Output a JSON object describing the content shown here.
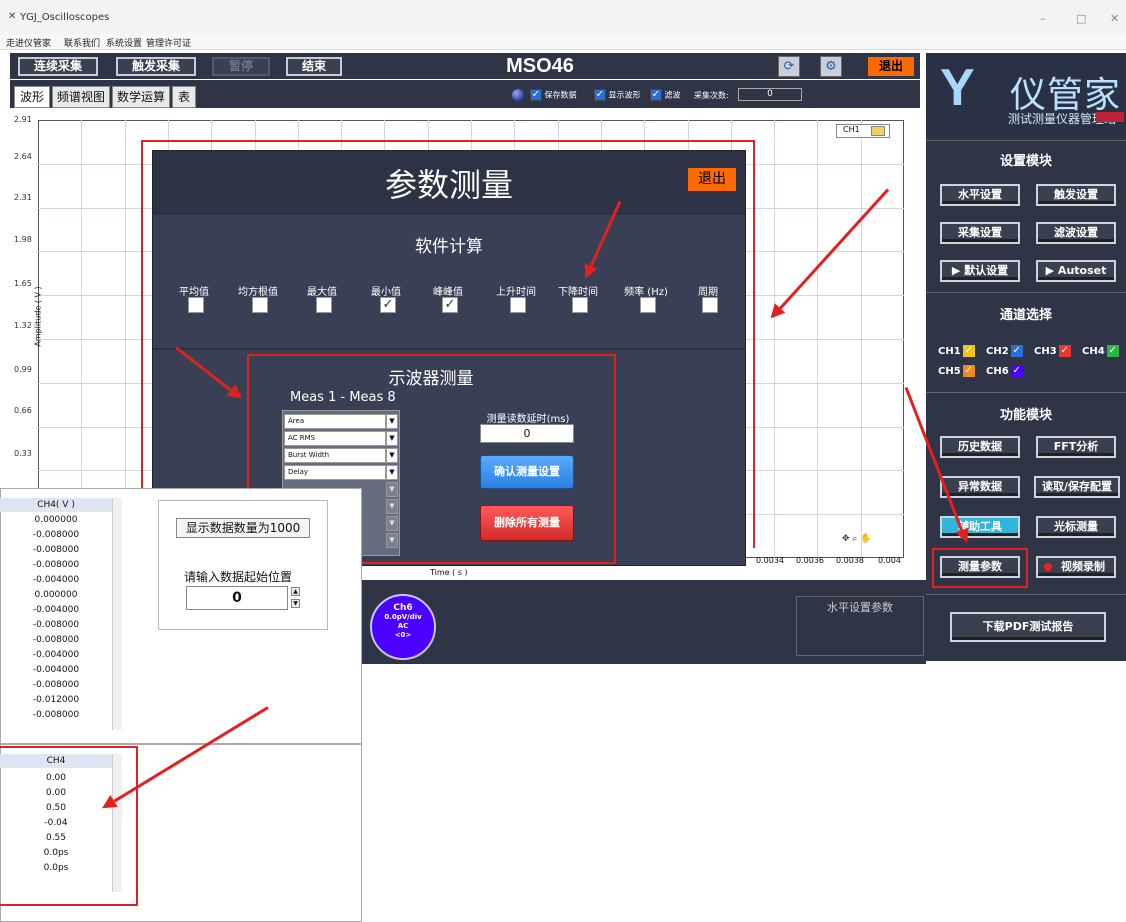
{
  "window": {
    "title": "YGJ_Oscilloscopes",
    "controls": [
      "–",
      "□",
      "✕"
    ]
  },
  "menu": [
    "走进仪管家",
    "联系我们",
    "系统设置",
    "管理许可证"
  ],
  "toolbar": {
    "continuous": "连续采集",
    "trigger": "触发采集",
    "pause": "暂停",
    "end": "结束",
    "model": "MSO46",
    "exit": "退出"
  },
  "tabs": [
    "波形",
    "频谱视图",
    "数学运算",
    "表"
  ],
  "options": {
    "save": "保存数据",
    "show_wave": "显示波形",
    "filter": "滤波",
    "count_label": "采集次数:",
    "count_value": "0"
  },
  "plot": {
    "ylabel": "Amplitude ( V )",
    "yticks": [
      "2.91",
      "2.64",
      "2.31",
      "1.98",
      "1.65",
      "1.32",
      "0.99",
      "0.66",
      "0.33"
    ],
    "xlabel": "Time ( s )",
    "xticks": [
      "0.0034",
      "0.0036",
      "0.0038",
      "0.004"
    ],
    "legend": "CH1"
  },
  "sidebar": {
    "logo_name": "仪管家",
    "logo_sub": "测试测量仪器管理站",
    "settings_title": "设置模块",
    "settings": [
      "水平设置",
      "触发设置",
      "采集设置",
      "滤波设置",
      "▶ 默认设置",
      "▶ Autoset"
    ],
    "channel_title": "通道选择",
    "channels": [
      "CH1",
      "CH2",
      "CH3",
      "CH4",
      "CH5",
      "CH6"
    ],
    "func_title": "功能模块",
    "funcs": [
      "历史数据",
      "FFT分析",
      "异常数据",
      "读取/保存配置",
      "辅助工具",
      "光标测量",
      "测量参数",
      "视频录制"
    ],
    "report": "下载PDF测试报告"
  },
  "modal": {
    "title": "参数测量",
    "exit": "退出",
    "soft_title": "软件计算",
    "params": [
      {
        "label": "平均值",
        "checked": false
      },
      {
        "label": "均方根值",
        "checked": false
      },
      {
        "label": "最大值",
        "checked": false
      },
      {
        "label": "最小值",
        "checked": true
      },
      {
        "label": "峰峰值",
        "checked": true
      },
      {
        "label": "上升时间",
        "checked": false
      },
      {
        "label": "下降时间",
        "checked": false
      },
      {
        "label": "频率 (Hz)",
        "checked": false
      },
      {
        "label": "周期",
        "checked": false
      }
    ],
    "scope_title": "示波器测量",
    "meas_range": "Meas 1 - Meas 8",
    "meas_items": [
      "Area",
      "AC RMS",
      "Burst Width",
      "Delay"
    ],
    "delay_label": "测量读数延时(ms)",
    "delay_value": "0",
    "confirm": "确认测量设置",
    "delete_all": "删除所有测量"
  },
  "ch6": {
    "name": "Ch6",
    "scale": "0.0pV/div",
    "coupling": "AC",
    "offset": "<0>"
  },
  "horizontal": "水平设置参数",
  "table1": {
    "header": "CH4( V )",
    "values": [
      "0.000000",
      "-0.008000",
      "-0.008000",
      "-0.008000",
      "-0.004000",
      "0.000000",
      "-0.004000",
      "-0.008000",
      "-0.008000",
      "-0.004000",
      "-0.004000",
      "-0.008000",
      "-0.012000",
      "-0.008000"
    ],
    "display_count": "显示数据数量为1000",
    "start_label": "请输入数据起始位置",
    "start_value": "0"
  },
  "table2": {
    "header": "CH4",
    "values": [
      "0.00",
      "0.00",
      "0.50",
      "-0.04",
      "0.55",
      "0.0ps",
      "0.0ps"
    ]
  }
}
